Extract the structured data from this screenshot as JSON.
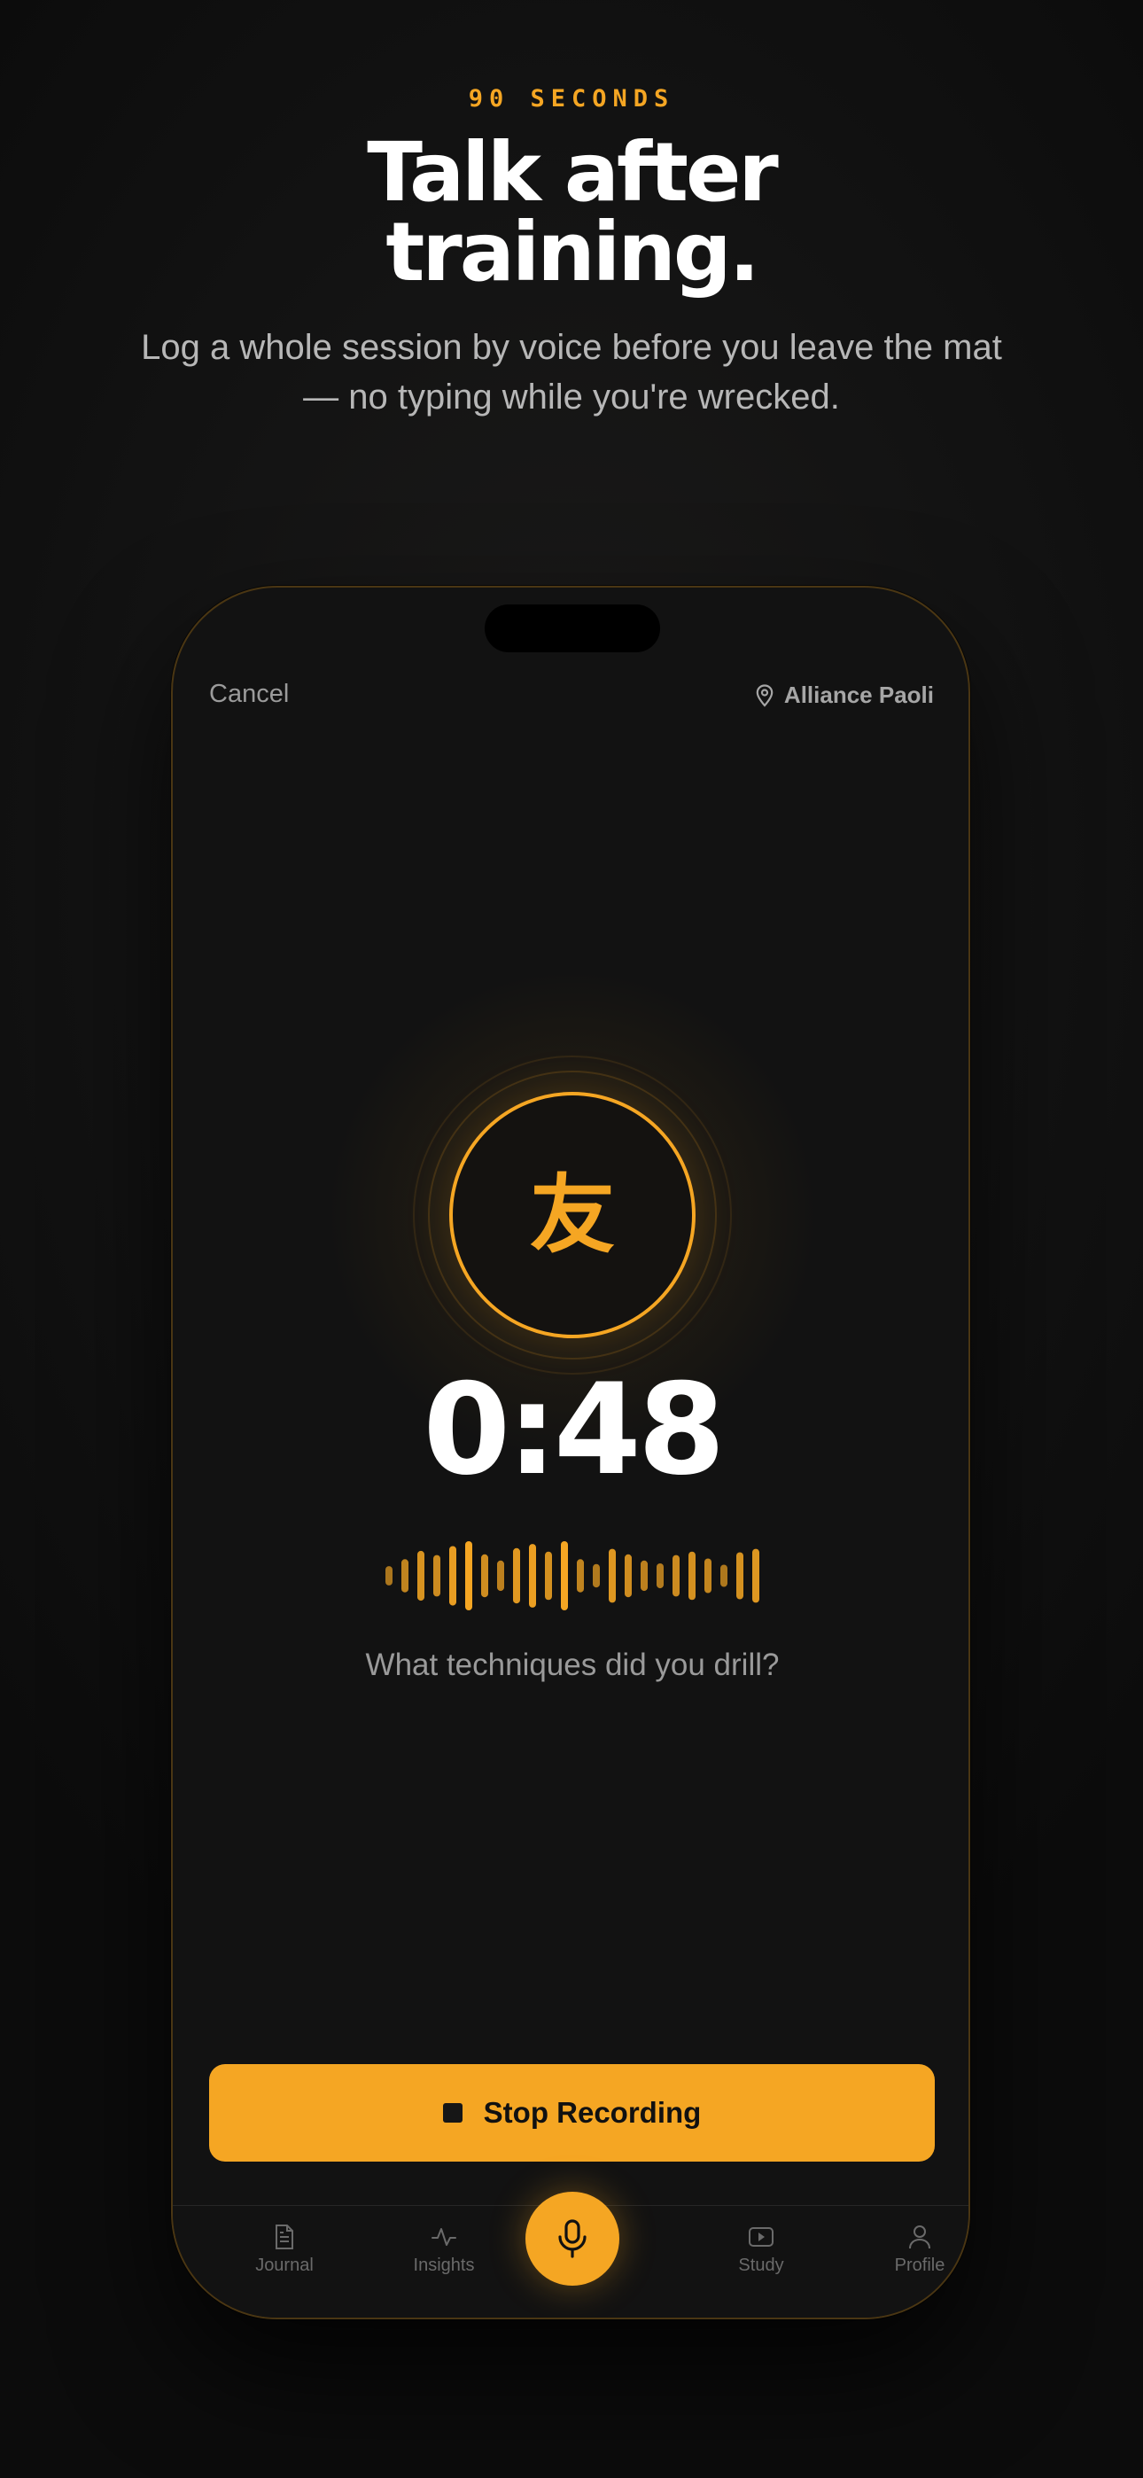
{
  "header": {
    "eyebrow": "90 SECONDS",
    "headline_line1": "Talk after",
    "headline_line2": "training.",
    "subtitle": "Log a whole session by voice before you leave the mat — no typing while you're wrecked."
  },
  "recorder": {
    "cancel_label": "Cancel",
    "gym_name": "Alliance Paoli",
    "mic_glyph": "友",
    "timer": "0:48",
    "prompt": "What techniques did you drill?",
    "stop_label": "Stop Recording",
    "waveform_levels": [
      0.28,
      0.48,
      0.72,
      0.6,
      0.86,
      1.0,
      0.62,
      0.44,
      0.8,
      0.92,
      0.7,
      1.0,
      0.48,
      0.34,
      0.78,
      0.62,
      0.44,
      0.36,
      0.6,
      0.7,
      0.5,
      0.32,
      0.68,
      0.78
    ]
  },
  "tabs": [
    {
      "id": "journal",
      "label": "Journal",
      "icon": "document-icon"
    },
    {
      "id": "insights",
      "label": "Insights",
      "icon": "activity-icon"
    },
    {
      "id": "record",
      "label": "",
      "icon": "mic-icon"
    },
    {
      "id": "study",
      "label": "Study",
      "icon": "play-icon"
    },
    {
      "id": "profile",
      "label": "Profile",
      "icon": "user-icon"
    }
  ],
  "colors": {
    "accent": "#f5a623",
    "background": "#121212",
    "text_muted": "#9a9a9a"
  }
}
